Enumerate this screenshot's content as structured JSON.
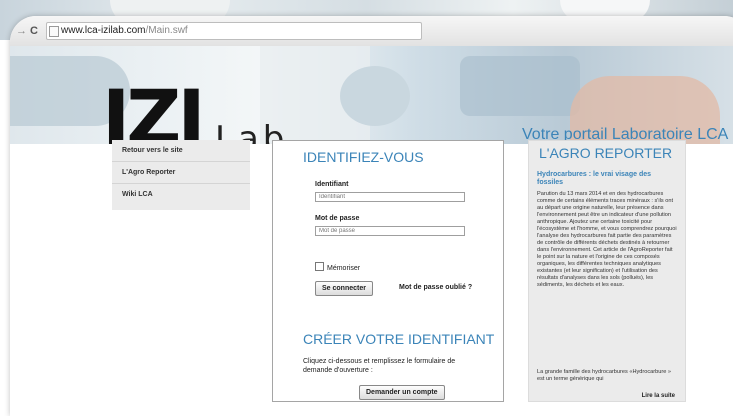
{
  "browser": {
    "back_icon": "→",
    "reload_icon": "C",
    "url_domain": "www.lca-izilab.com",
    "url_path": "/Main.swf"
  },
  "banner": {
    "logo_main": "IZI",
    "logo_sub": "Lab",
    "tagline": "Votre portail Laboratoire LCA"
  },
  "sidebar": {
    "items": [
      {
        "label": "Retour vers le site"
      },
      {
        "label": "L'Agro Reporter"
      },
      {
        "label": "Wiki LCA"
      }
    ]
  },
  "login": {
    "title": "IDENTIFIEZ-VOUS",
    "id_label": "Identifiant",
    "id_placeholder": "Identifiant",
    "pw_label": "Mot de passe",
    "pw_placeholder": "Mot de passe",
    "remember_label": "Mémoriser",
    "connect_button": "Se connecter",
    "forgot_link": "Mot de passe oublié ?",
    "create_title": "CRÉER VOTRE IDENTIFIANT",
    "create_text": "Cliquez ci-dessous et remplissez le formulaire de demande d'ouverture :",
    "request_button": "Demander un compte"
  },
  "agro_reporter": {
    "title": "L'AGRO REPORTER",
    "headline": "Hydrocarbures : le vrai visage des fossiles",
    "body": "Parution du 13 mars 2014 et en des hydrocarbures comme de certains éléments traces minéraux : s'ils ont au départ une origine naturelle, leur présence dans l'environnement peut être un indicateur d'une pollution anthropique. Ajoutez une certaine toxicité pour l'écosystème et l'homme, et vous comprendrez pourquoi l'analyse des hydrocarbures fait partie des paramètres de contrôle de différents déchets destinés à retourner dans l'environnement. Cet article de l'AgroReporter fait le point sur la nature et l'origine de ces composés organiques, les différentes techniques analytiques existantes (et leur signification) et l'utilisation des résultats d'analyses dans les sols (pollués), les sédiments, les déchets et les eaux.",
    "more": "La grande famille des hydrocarbures «Hydrocarbure » est un terme générique qui",
    "read_more": "Lire la suite"
  }
}
